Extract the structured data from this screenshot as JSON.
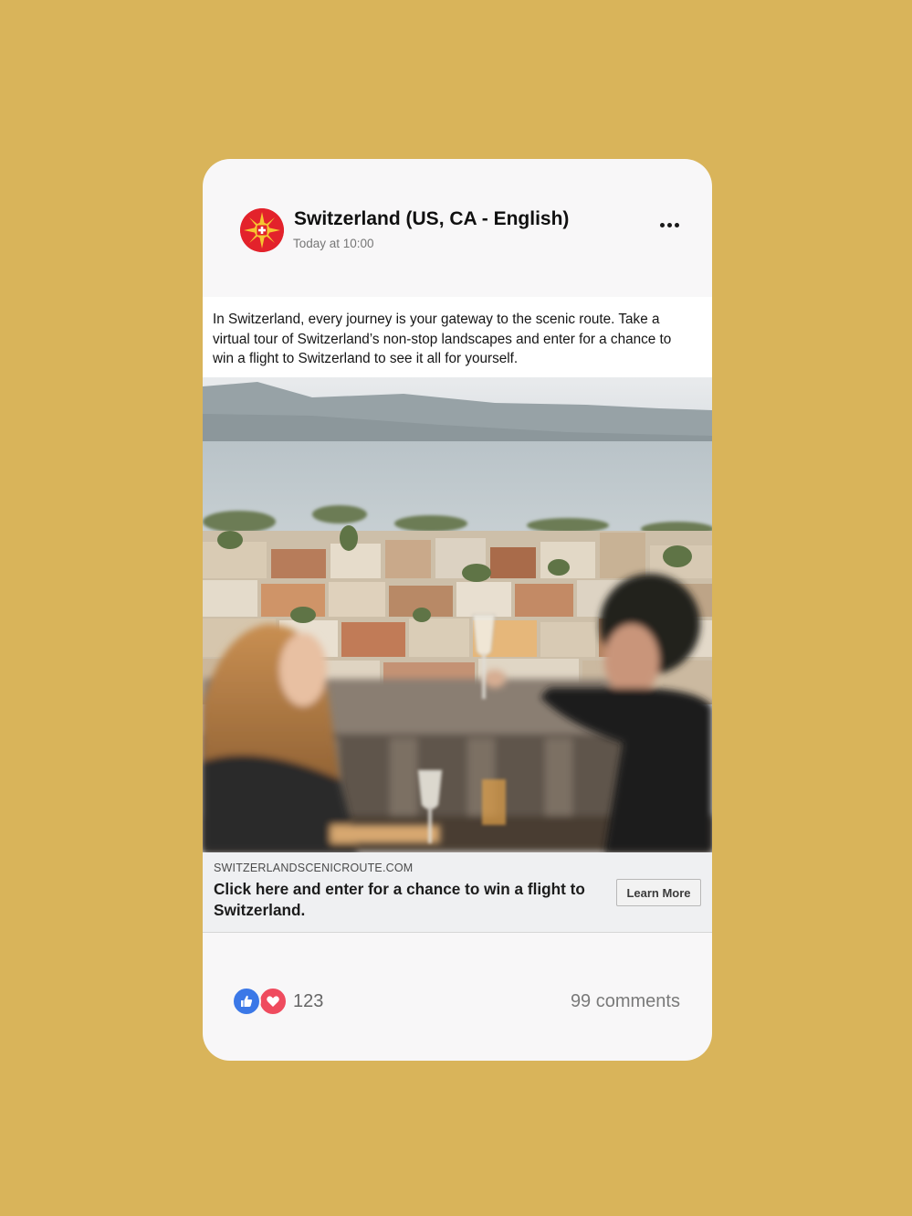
{
  "post": {
    "page_name": "Switzerland (US, CA - English)",
    "timestamp": "Today at 10:00",
    "caption": "In Switzerland, every journey is your gateway to the scenic route. Take a virtual tour of Switzerland’s non-stop landscapes and enter for a chance to win a flight to Switzerland to see it all for yourself.",
    "avatar_icon": "switzerland-tourism-logo",
    "more_icon": "more-options-icon"
  },
  "link_preview": {
    "domain": "SWITZERLANDSCENICROUTE.COM",
    "headline": "Click here and enter for a chance to win a flight to Switzerland.",
    "cta_label": "Learn More"
  },
  "engagement": {
    "reaction_icons": [
      "like-icon",
      "love-icon"
    ],
    "reaction_count": "123",
    "comments": "99 comments"
  },
  "colors": {
    "background": "#d9b45a",
    "card": "#f8f7f8",
    "like": "#3b78e7",
    "love": "#ef4b5e",
    "brand_red": "#e3222b"
  }
}
